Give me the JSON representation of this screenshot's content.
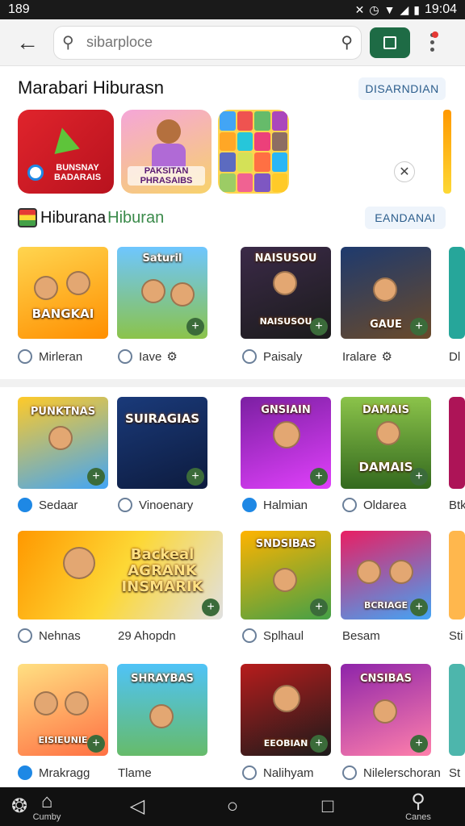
{
  "status_bar": {
    "left_text": "189",
    "time": "19:04",
    "icons": [
      "nfc-icon",
      "alarm-icon",
      "wifi-icon",
      "signal-icon",
      "battery-icon"
    ]
  },
  "topbar": {
    "back_icon": "arrow-left-icon",
    "search": {
      "placeholder": "sibarploce",
      "value": ""
    },
    "colors": {
      "accent": "#1e6b45",
      "notify": "#e53935"
    }
  },
  "section_main": {
    "title": "Marabari Hiburasn",
    "action": "DISARNDIAN"
  },
  "featured": [
    {
      "label": "BUNSNAY BADARAIS"
    },
    {
      "label": "PAKSITAN PHRASAIBS"
    },
    {
      "label": ""
    }
  ],
  "subsection": {
    "title": "Hiburana",
    "title_accent": "Hiburan",
    "action": "EANDANAI"
  },
  "row1": [
    {
      "title": "BANGKAI",
      "caption": "Mirleran"
    },
    {
      "title": "Saturil",
      "caption": "Iave"
    },
    {
      "title": "NAISUSOU",
      "caption": "Paisaly"
    },
    {
      "title": "GAUE",
      "caption": "Iralare"
    },
    {
      "title": "",
      "caption": "Dl"
    }
  ],
  "row2": [
    {
      "title": "PUNKTNAS",
      "caption": "Sedaar"
    },
    {
      "title": "SUIRAGIAS",
      "caption": "Vinoenary"
    },
    {
      "title": "GNSIAIN",
      "caption": "Halmian"
    },
    {
      "title": "DAMAIS",
      "caption": "Oldarea"
    },
    {
      "title": "",
      "caption": "Btk"
    }
  ],
  "row3": [
    {
      "title": "Backeal AGRANK INSMARIK",
      "caption": "Nehnas",
      "wide": true
    },
    {
      "title": "",
      "caption": "29 Ahopdn",
      "spacer": true
    },
    {
      "title": "SNDSIBAS",
      "caption": "Splhaul"
    },
    {
      "title": "BCRIAGE",
      "caption": "Besam"
    },
    {
      "title": "",
      "caption": "Sti"
    }
  ],
  "row4": [
    {
      "title": "EISIEUNIE",
      "caption": "Mrakragg"
    },
    {
      "title": "SHRAYBAS",
      "caption": "Tlame"
    },
    {
      "title": "EEOBIAN",
      "caption": "Nalihyam"
    },
    {
      "title": "CNSIBAS",
      "caption": "Nilelerschoran"
    },
    {
      "title": "",
      "caption": "St"
    }
  ],
  "bottom_nav": {
    "items": [
      {
        "icon": "pinwheel-icon",
        "label": ""
      },
      {
        "icon": "home-icon",
        "label": "Cumby"
      },
      {
        "icon": "back-triangle-icon",
        "label": ""
      },
      {
        "icon": "home-circle-icon",
        "label": ""
      },
      {
        "icon": "recents-square-icon",
        "label": ""
      },
      {
        "icon": "search-icon",
        "label": "Canes"
      }
    ]
  }
}
